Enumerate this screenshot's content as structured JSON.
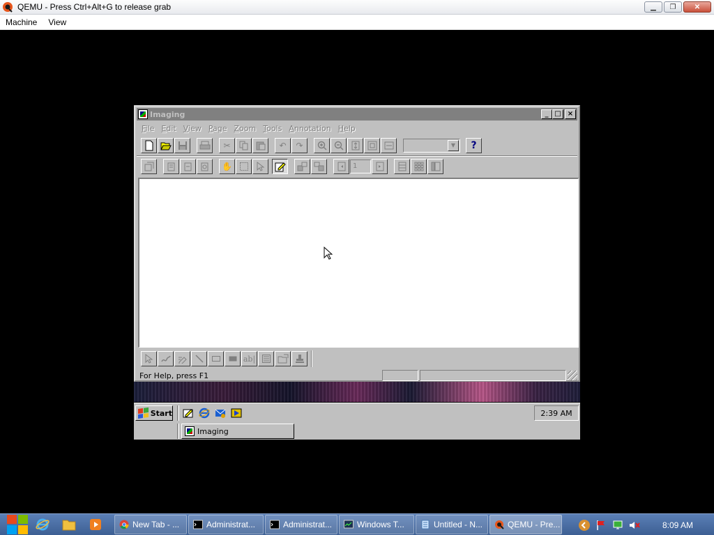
{
  "host": {
    "title": "QEMU - Press Ctrl+Alt+G to release grab",
    "menu": [
      "Machine",
      "View"
    ]
  },
  "imaging": {
    "title": "Imaging",
    "menu": [
      {
        "label": "File",
        "u": "F",
        "rest": "ile"
      },
      {
        "label": "Edit",
        "u": "E",
        "rest": "dit"
      },
      {
        "label": "View",
        "u": "V",
        "rest": "iew"
      },
      {
        "label": "Page",
        "u": "P",
        "rest": "age"
      },
      {
        "label": "Zoom",
        "u": "Z",
        "rest": "oom"
      },
      {
        "label": "Tools",
        "u": "T",
        "rest": "ools"
      },
      {
        "label": "Annotation",
        "u": "A",
        "rest": "nnotation"
      },
      {
        "label": "Help",
        "u": "H",
        "rest": "elp"
      }
    ],
    "help_button": "?",
    "page_number": "1",
    "status_text": "For Help, press F1"
  },
  "guest_taskbar": {
    "start_label": "Start",
    "clock": "2:39 AM",
    "task_label": "Imaging"
  },
  "host_taskbar": {
    "tasks": [
      "New Tab - ...",
      "Administrat...",
      "Administrat...",
      "Windows T...",
      "Untitled - N...",
      "QEMU - Pre..."
    ],
    "clock": "8:09 AM"
  },
  "colors": {
    "win95_gray": "#c0c0c0",
    "win95_inactive_title": "#808080",
    "host_taskbar": "#4a6ea5"
  }
}
